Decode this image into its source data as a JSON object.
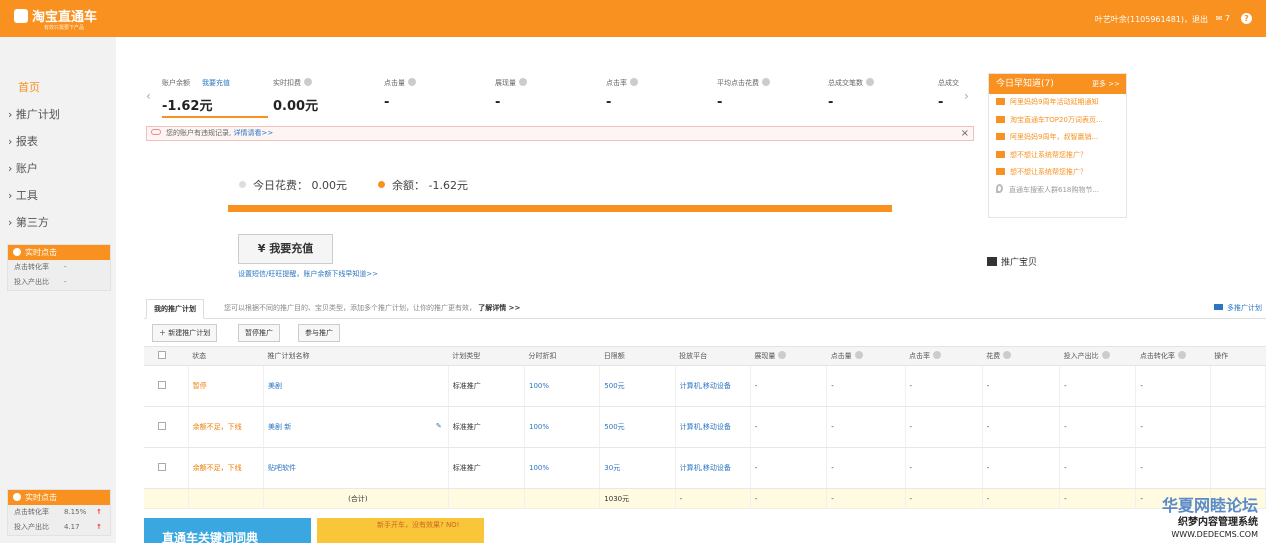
{
  "header": {
    "logo": "淘宝直通车",
    "slogan": "有效只需要下产品",
    "user": "叶艺叶余(1105961481)，退出",
    "message_count": "7",
    "help": "?"
  },
  "sidebar": {
    "home": "首页",
    "items": [
      "推广计划",
      "报表",
      "账户",
      "工具",
      "第三方"
    ],
    "realtime_top": {
      "title": "实时点击",
      "rows": [
        {
          "label": "点击转化率",
          "value": "-"
        },
        {
          "label": "投入产出比",
          "value": "-"
        }
      ]
    },
    "realtime_bottom": {
      "title": "实时点击",
      "rows": [
        {
          "label": "点击转化率",
          "value": "8.15%"
        },
        {
          "label": "投入产出比",
          "value": "4.17"
        }
      ]
    }
  },
  "stats": {
    "balance_label": "账户余额",
    "recharge_link": "我要充值",
    "balance": "-1.62元",
    "realtime_label": "实时扣费",
    "realtime": "0.00元",
    "items": [
      {
        "label": "点击量",
        "value": "-"
      },
      {
        "label": "展现量",
        "value": "-"
      },
      {
        "label": "点击率",
        "value": "-"
      },
      {
        "label": "平均点击花费",
        "value": "-"
      },
      {
        "label": "总成交笔数",
        "value": "-"
      },
      {
        "label": "总成交",
        "value": "-"
      }
    ]
  },
  "alert": {
    "text": "您的账户有违规记录,",
    "link": "详情请看>>",
    "close": "×"
  },
  "news": {
    "title": "今日早知道(7)",
    "more": "更多 >>",
    "items": [
      "阿里妈妈9周年活动延期通知",
      "淘宝直通车TOP20万词表页...",
      "阿里妈妈9周年，叔智赢销...",
      "想不想让系统帮您推广？",
      "想不想让系统帮您推广？"
    ],
    "last": "直通车搜索人群618购物节..."
  },
  "budget": {
    "today_label": "今日花费：",
    "today": "0.00元",
    "balance_label": "余额：",
    "balance": "-1.62元"
  },
  "recharge_button": "¥ 我要充值",
  "settings_link": "设置短信/旺旺提醒，账户余额下线早知道>>",
  "promote_link": "推广宝贝",
  "plans": {
    "tab": "我的推广计划",
    "desc": "您可以根据不同的推广目的、宝贝类型，添加多个推广计划，让你的推广更有效，",
    "learn": "了解详情 >>",
    "multi": "多推广计划",
    "buttons": [
      "新建推广计划",
      "暂停推广",
      "参与推广"
    ],
    "columns": [
      "状态",
      "推广计划名称",
      "计划类型",
      "分时折扣",
      "日限额",
      "投放平台",
      "展现量",
      "点击量",
      "点击率",
      "花费",
      "投入产出比",
      "点击转化率",
      "操作"
    ],
    "rows": [
      {
        "status": "暂停",
        "name": "美剧",
        "type": "标准推广",
        "discount": "100%",
        "limit": "500元",
        "platform": "计算机,移动设备"
      },
      {
        "status": "余额不足，下线",
        "name": "美剧 新",
        "type": "标准推广",
        "discount": "100%",
        "limit": "500元",
        "platform": "计算机,移动设备"
      },
      {
        "status": "余额不足，下线",
        "name": "贴吧软件",
        "type": "标准推广",
        "discount": "100%",
        "limit": "30元",
        "platform": "计算机,移动设备"
      }
    ],
    "total_label": "(合计)",
    "total_limit": "1030元",
    "dash": "-"
  },
  "banners": {
    "left": "直通车关键词词典",
    "right": "新手开车，没有效果? NO!"
  },
  "watermark": {
    "line1": "华夏网睦论坛",
    "line2": "织梦内容管理系统",
    "line3": "WWW.DEDECMS.COM"
  },
  "colors": {
    "brand": "#f8911f",
    "link": "#2b75c2"
  }
}
